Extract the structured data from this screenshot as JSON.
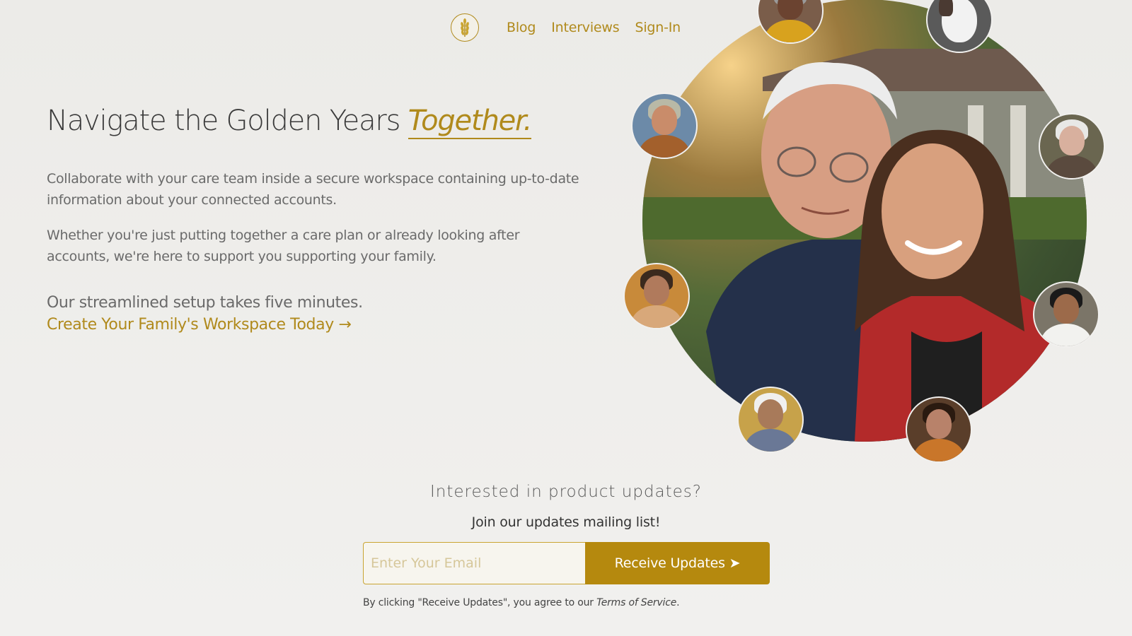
{
  "nav": {
    "logo_icon": "wheat-icon",
    "links": [
      "Blog",
      "Interviews",
      "Sign-In"
    ]
  },
  "hero": {
    "title": "Navigate the Golden Years",
    "title_accent": "Together.",
    "paragraph1": "Collaborate with your care team inside a secure workspace containing up-to-date information about your connected accounts.",
    "paragraph2": "Whether you're just putting together a care plan or already looking after accounts, we're here to support you supporting your family.",
    "setup_text": "Our streamlined setup takes five minutes.",
    "cta_label": "Create Your Family's Workspace Today →"
  },
  "newsletter": {
    "title": "Interested in product updates?",
    "subtitle": "Join our updates mailing list!",
    "email_placeholder": "Enter Your Email",
    "email_value": "",
    "button_label": "Receive Updates ➤",
    "terms_prefix": "By clicking \"Receive Updates\", you agree to our ",
    "terms_link": "Terms of Service",
    "terms_suffix": "."
  },
  "colors": {
    "accent": "#b08a1c",
    "button": "#b5890e",
    "background": "#eeede9",
    "text": "#4a4a4a"
  }
}
